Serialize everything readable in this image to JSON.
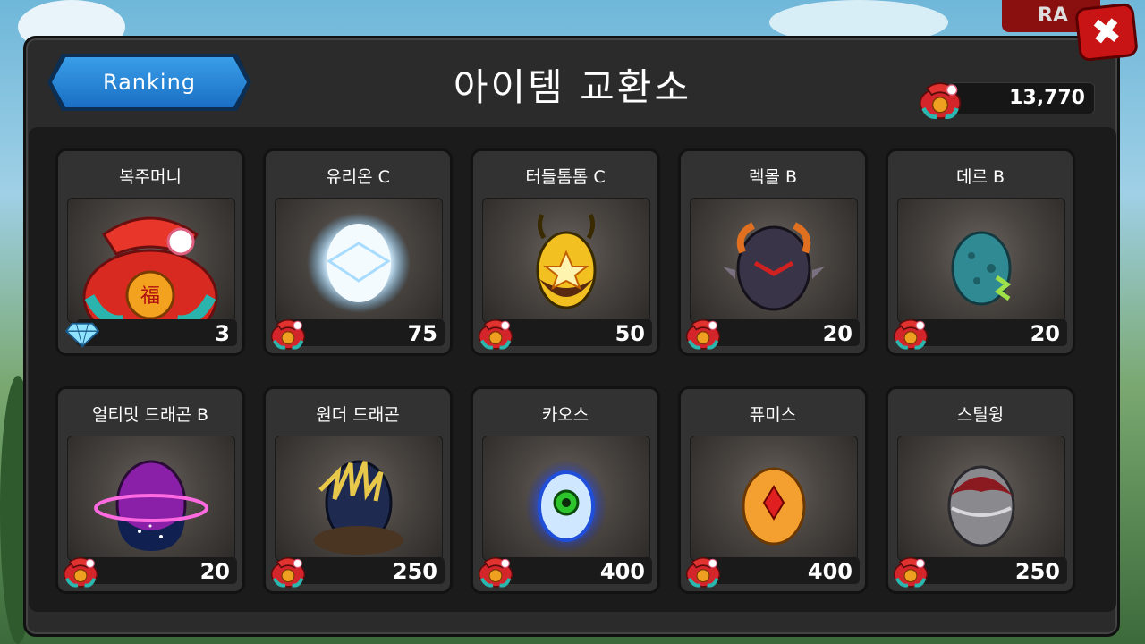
{
  "header": {
    "ranking_label": "Ranking",
    "title": "아이템 교환소",
    "currency_value": "13,770",
    "close_symbol": "✖",
    "rank_tab_label": "RA"
  },
  "items": [
    {
      "name": "복주머니",
      "price": "3",
      "currency": "gem"
    },
    {
      "name": "유리온 C",
      "price": "75",
      "currency": "pouch"
    },
    {
      "name": "터들톰톰 C",
      "price": "50",
      "currency": "pouch"
    },
    {
      "name": "렉몰 B",
      "price": "20",
      "currency": "pouch"
    },
    {
      "name": "데르 B",
      "price": "20",
      "currency": "pouch"
    },
    {
      "name": "얼티밋 드래곤 B",
      "price": "20",
      "currency": "pouch"
    },
    {
      "name": "원더 드래곤",
      "price": "250",
      "currency": "pouch"
    },
    {
      "name": "카오스",
      "price": "400",
      "currency": "pouch"
    },
    {
      "name": "퓨미스",
      "price": "400",
      "currency": "pouch"
    },
    {
      "name": "스틸윙",
      "price": "250",
      "currency": "pouch"
    }
  ],
  "colors": {
    "panel": "#2b2b2b",
    "ranking_button": "#1a6fc4",
    "close_button": "#c81414",
    "pouch_red": "#d4262a"
  },
  "icons": {
    "currency": "lucky-pouch-icon",
    "gem": "diamond-icon",
    "close": "close-icon"
  }
}
